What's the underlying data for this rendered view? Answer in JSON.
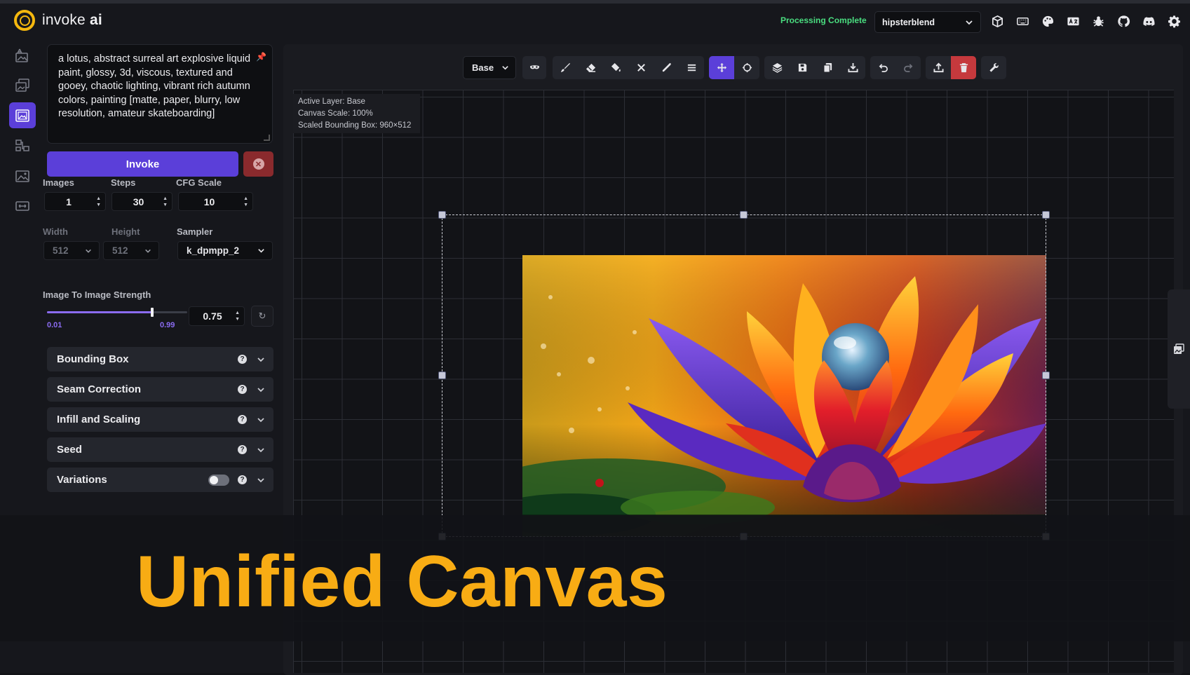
{
  "app": {
    "logo_word1": "invoke",
    "logo_word2": "ai",
    "status": "Processing Complete",
    "model": "hipsterblend",
    "header_icons": [
      "cube-icon",
      "keyboard-icon",
      "palette-icon",
      "translate-icon",
      "bug-icon",
      "github-icon",
      "discord-icon",
      "settings-gear-icon"
    ]
  },
  "nav": {
    "items": [
      "text-to-image-icon",
      "image-to-image-icon",
      "unified-canvas-icon",
      "nodes-icon",
      "postprocessing-icon",
      "training-icon"
    ],
    "active_index": 2
  },
  "panel": {
    "prompt": "a lotus, abstract surreal art explosive liquid paint, glossy, 3d, viscous, textured and gooey, chaotic lighting, vibrant rich autumn colors, painting [matte, paper, blurry, low resolution, amateur skateboarding]",
    "invoke_label": "Invoke",
    "images_label": "Images",
    "images_value": "1",
    "steps_label": "Steps",
    "steps_value": "30",
    "cfg_label": "CFG Scale",
    "cfg_value": "10",
    "width_label": "Width",
    "width_value": "512",
    "height_label": "Height",
    "height_value": "512",
    "sampler_label": "Sampler",
    "sampler_value": "k_dpmpp_2",
    "strength_label": "Image To Image Strength",
    "strength_min": "0.01",
    "strength_max": "0.99",
    "strength_value": "0.75",
    "strength_fraction": 0.75,
    "accordions": [
      {
        "label": "Bounding Box"
      },
      {
        "label": "Seam Correction"
      },
      {
        "label": "Infill and Scaling"
      },
      {
        "label": "Seed"
      },
      {
        "label": "Variations"
      }
    ]
  },
  "canvas": {
    "layer_select": "Base",
    "info_active_layer": "Active Layer: Base",
    "info_canvas_scale": "Canvas Scale: 100%",
    "info_bounding_box": "Scaled Bounding Box: 960×512"
  },
  "banner": {
    "title": "Unified Canvas"
  },
  "colors": {
    "accent": "#5b3fd9",
    "brand_yellow": "#f5b80e",
    "banner_text": "#f8ac14",
    "status_green": "#4ade80",
    "danger": "#c5393d"
  }
}
